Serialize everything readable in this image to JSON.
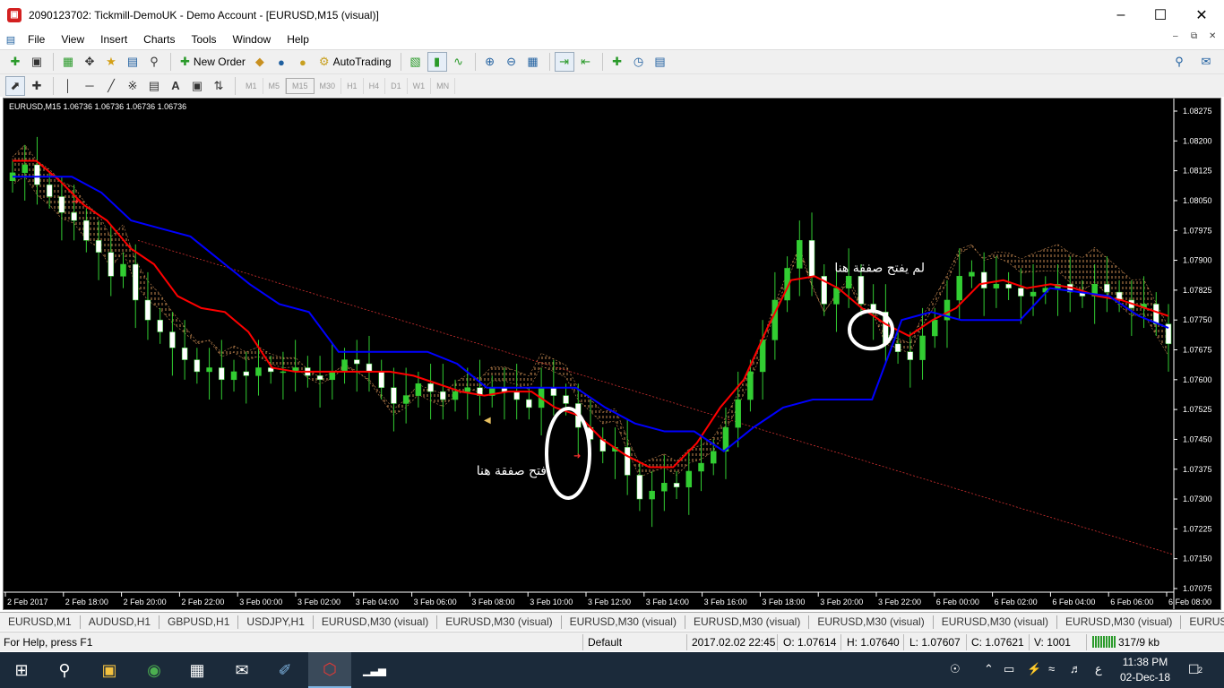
{
  "window": {
    "title": "2090123702: Tickmill-DemoUK - Demo Account - [EURUSD,M15 (visual)]"
  },
  "menu": [
    "File",
    "View",
    "Insert",
    "Charts",
    "Tools",
    "Window",
    "Help"
  ],
  "toolbar": {
    "new_order_label": "New Order",
    "autotrading_label": "AutoTrading",
    "timeframes": [
      "M1",
      "M5",
      "M15",
      "M30",
      "H1",
      "H4",
      "D1",
      "W1",
      "MN"
    ]
  },
  "chart": {
    "symbol_info": "EURUSD,M15  1.06736 1.06736 1.06736 1.06736",
    "annotation_open": "فتح صفقة هنا",
    "annotation_no_open": "لم يفتح صفقة هنا",
    "colors": {
      "background": "#000000",
      "bull_candle": "#32cd32",
      "bear_candle": "#ffffff",
      "tenkan": "#ff0000",
      "kijun": "#0000ff",
      "cloud": "#e8a060"
    }
  },
  "chart_data": {
    "type": "candlestick",
    "symbol": "EURUSD",
    "timeframe": "M15",
    "y_ticks": [
      "1.08275",
      "1.08200",
      "1.08125",
      "1.08050",
      "1.07975",
      "1.07900",
      "1.07825",
      "1.07750",
      "1.07675",
      "1.07600",
      "1.07525",
      "1.07450",
      "1.07375",
      "1.07300",
      "1.07225",
      "1.07150",
      "1.07075"
    ],
    "ylim": [
      1.07075,
      1.08275
    ],
    "x_ticks": [
      "2 Feb 2017",
      "2 Feb 18:00",
      "2 Feb 20:00",
      "2 Feb 22:00",
      "3 Feb 00:00",
      "3 Feb 02:00",
      "3 Feb 04:00",
      "3 Feb 06:00",
      "3 Feb 08:00",
      "3 Feb 10:00",
      "3 Feb 12:00",
      "3 Feb 14:00",
      "3 Feb 16:00",
      "3 Feb 18:00",
      "3 Feb 20:00",
      "3 Feb 22:00",
      "6 Feb 00:00",
      "6 Feb 02:00",
      "6 Feb 04:00",
      "6 Feb 06:00",
      "6 Feb 08:00"
    ],
    "close_series": [
      1.0812,
      1.0814,
      1.0809,
      1.0806,
      1.0802,
      1.08,
      1.0795,
      1.0792,
      1.0786,
      1.0789,
      1.078,
      1.0775,
      1.0772,
      1.0768,
      1.0765,
      1.0762,
      1.0763,
      1.076,
      1.0762,
      1.0761,
      1.0763,
      1.0762,
      1.0762,
      1.0763,
      1.0761,
      1.076,
      1.0762,
      1.0765,
      1.0764,
      1.0762,
      1.0758,
      1.0754,
      1.0756,
      1.0759,
      1.0757,
      1.0755,
      1.0757,
      1.0758,
      1.0756,
      1.0758,
      1.0757,
      1.0755,
      1.0753,
      1.0758,
      1.0756,
      1.0754,
      1.0748,
      1.0745,
      1.0742,
      1.0743,
      1.0736,
      1.073,
      1.0732,
      1.0734,
      1.0733,
      1.0737,
      1.0739,
      1.0742,
      1.0748,
      1.0755,
      1.0762,
      1.077,
      1.078,
      1.0788,
      1.0795,
      1.0786,
      1.0779,
      1.0783,
      1.0786,
      1.0779,
      1.0777,
      1.0769,
      1.0767,
      1.0765,
      1.0771,
      1.0775,
      1.078,
      1.0786,
      1.0787,
      1.0783,
      1.0784,
      1.0783,
      1.0781,
      1.0782,
      1.0783,
      1.0784,
      1.0782,
      1.0781,
      1.0784,
      1.0782,
      1.078,
      1.0778,
      1.0779,
      1.0774,
      1.0769
    ],
    "tenkan_sen": [
      1.0815,
      1.0815,
      1.081,
      1.0804,
      1.08,
      1.0793,
      1.0789,
      1.0781,
      1.0778,
      1.0777,
      1.0772,
      1.0763,
      1.0762,
      1.0762,
      1.0762,
      1.0762,
      1.0762,
      1.0761,
      1.0759,
      1.0757,
      1.0756,
      1.0757,
      1.0757,
      1.0753,
      1.0751,
      1.0745,
      1.0741,
      1.0738,
      1.0738,
      1.0744,
      1.0753,
      1.076,
      1.0773,
      1.0785,
      1.0786,
      1.0783,
      1.0778,
      1.0774,
      1.0771,
      1.0775,
      1.0778,
      1.0784,
      1.0785,
      1.0783,
      1.0784,
      1.0783,
      1.0781,
      1.078,
      1.0778,
      1.0776
    ],
    "kijun_sen": [
      1.0811,
      1.0811,
      1.0811,
      1.0807,
      1.08,
      1.0798,
      1.0796,
      1.079,
      1.0784,
      1.0779,
      1.0777,
      1.0767,
      1.0767,
      1.0767,
      1.0767,
      1.0764,
      1.0758,
      1.0758,
      1.0758,
      1.0758,
      1.0753,
      1.0749,
      1.0747,
      1.0747,
      1.0742,
      1.0748,
      1.0753,
      1.0755,
      1.0755,
      1.0755,
      1.0775,
      1.0777,
      1.0775,
      1.0775,
      1.0775,
      1.0783,
      1.0782,
      1.0781,
      1.0776,
      1.0773
    ],
    "annotations": [
      {
        "text": "فتح صفقة هنا",
        "price": 1.0738,
        "time": "3 Feb 10:45"
      },
      {
        "text": "لم يفتح صفقة هنا",
        "price": 1.0787,
        "time": "3 Feb 21:00"
      }
    ],
    "grid": false
  },
  "tabs": [
    "EURUSD,M1",
    "AUDUSD,H1",
    "GBPUSD,H1",
    "USDJPY,H1",
    "EURUSD,M30 (visual)",
    "EURUSD,M30 (visual)",
    "EURUSD,M30 (visual)",
    "EURUSD,M30 (visual)",
    "EURUSD,M30 (visual)",
    "EURUSD,M30 (visual)",
    "EURUSD,M30 (visual)",
    "EURUSD,"
  ],
  "status": {
    "help": "For Help, press F1",
    "profile": "Default",
    "datetime": "2017.02.02 22:45",
    "open": "O: 1.07614",
    "high": "H: 1.07640",
    "low": "L: 1.07607",
    "close": "C: 1.07621",
    "volume": "V: 1001",
    "traffic": "317/9 kb"
  },
  "taskbar": {
    "time": "11:38 PM",
    "date": "02-Dec-18",
    "lang": "ع",
    "notifications": "2"
  }
}
